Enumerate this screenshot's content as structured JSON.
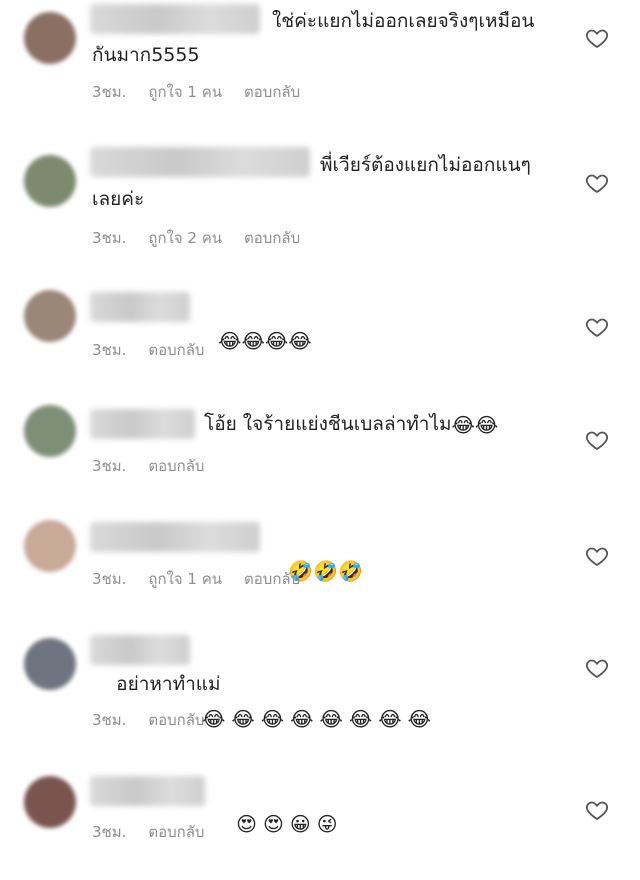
{
  "comments": [
    {
      "avatar_color": "#8a6f62",
      "text": "ใช่ค่ะแยกไม่ออกเลยจริงๆเหมือนกันมาก5555",
      "time": "3ชม.",
      "likes": "ถูกใจ 1 คน",
      "reply": "ตอบกลับ"
    },
    {
      "avatar_color": "#7d8a6e",
      "text": "พี่เวียร์ต้องแยกไม่ออกแนๆเลยค่ะ",
      "time": "3ชม.",
      "likes": "ถูกใจ 2 คน",
      "reply": "ตอบกลับ"
    },
    {
      "avatar_color": "#9b8678",
      "emojis": "😂😂😂😂",
      "time": "3ชม.",
      "reply": "ตอบกลับ"
    },
    {
      "avatar_color": "#7e8f78",
      "text": "โอ้ย ใจร้ายแย่งชีนเบลล่าทำไม",
      "emojis": "😂😂",
      "time": "3ชม.",
      "reply": "ตอบกลับ"
    },
    {
      "avatar_color": "#c9a998",
      "emojis": "🤣🤣🤣",
      "time": "3ชม.",
      "likes": "ถูกใจ 1 คน",
      "reply": "ตอบกลับ"
    },
    {
      "avatar_color": "#6f7580",
      "text": "อย่าหาทำแม่",
      "emojis": "😂😂😂😂😂😂😂😂",
      "time": "3ชม.",
      "reply": "ตอบกลับ"
    },
    {
      "avatar_color": "#7a5550",
      "emojis": "😍😍😀😜",
      "time": "3ชม.",
      "reply": "ตอบกลับ"
    }
  ]
}
